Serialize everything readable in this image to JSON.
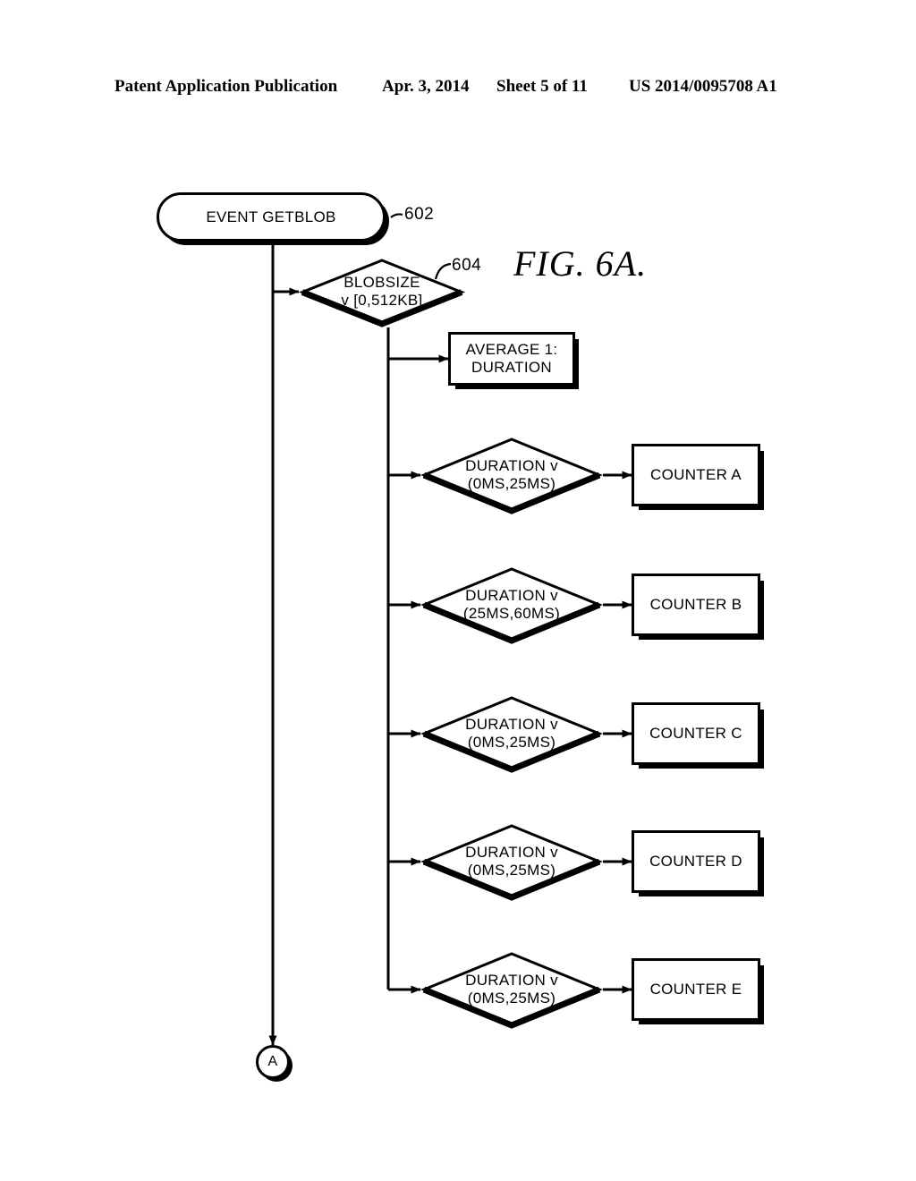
{
  "header": {
    "publication": "Patent Application Publication",
    "date": "Apr. 3, 2014",
    "sheet": "Sheet 5 of 11",
    "patent_number": "US 2014/0095708 A1"
  },
  "figure": {
    "caption": "FIG. 6A."
  },
  "flowchart": {
    "start_node": {
      "label": "EVENT GETBLOB",
      "ref": "602"
    },
    "blobsize_decision": {
      "label": "BLOBSIZE\nv [0,512KB]",
      "ref": "604"
    },
    "average_box": {
      "label": "AVERAGE 1:\nDURATION"
    },
    "branches": [
      {
        "decision": "DURATION v\n(0MS,25MS)",
        "counter": "COUNTER A"
      },
      {
        "decision": "DURATION v\n(25MS,60MS)",
        "counter": "COUNTER B"
      },
      {
        "decision": "DURATION v\n(0MS,25MS)",
        "counter": "COUNTER C"
      },
      {
        "decision": "DURATION v\n(0MS,25MS)",
        "counter": "COUNTER D"
      },
      {
        "decision": "DURATION v\n(0MS,25MS)",
        "counter": "COUNTER E"
      }
    ],
    "connector": {
      "label": "A"
    }
  },
  "colors": {
    "ink": "#000000",
    "paper": "#ffffff"
  }
}
